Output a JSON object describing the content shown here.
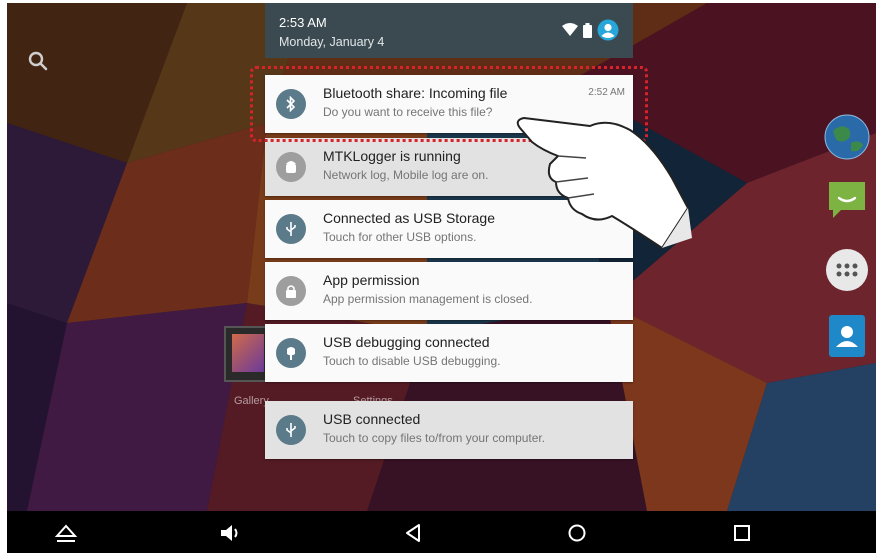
{
  "status_bar": {
    "time": "2:53 AM",
    "date": "Monday, January 4",
    "icons": [
      "wifi-icon",
      "battery-icon",
      "user-account-icon"
    ]
  },
  "notifications": [
    {
      "icon": "bluetooth-icon",
      "icon_color": "#5b7a8a",
      "title": "Bluetooth share: Incoming file",
      "subtitle": "Do you want to receive this file?",
      "time": "2:52 AM"
    },
    {
      "icon": "android-icon",
      "icon_color": "#9e9e9e",
      "title": "MTKLogger is running",
      "subtitle": "Network log, Mobile log are on."
    },
    {
      "icon": "usb-icon",
      "icon_color": "#5b7a8a",
      "title": "Connected as USB Storage",
      "subtitle": "Touch for other USB options."
    },
    {
      "icon": "lock-icon",
      "icon_color": "#9e9e9e",
      "title": "App permission",
      "subtitle": "App permission management is closed."
    },
    {
      "icon": "debug-icon",
      "icon_color": "#5b7a8a",
      "title": "USB debugging connected",
      "subtitle": "Touch to disable USB debugging."
    },
    {
      "icon": "usb-icon",
      "icon_color": "#5b7a8a",
      "title": "USB connected",
      "subtitle": "Touch to copy files to/from your computer."
    }
  ],
  "home_screen": {
    "labels": [
      "Gallery",
      "Settings"
    ],
    "dock_icons": [
      "browser-icon",
      "messaging-icon",
      "app-drawer-icon",
      "contacts-icon"
    ]
  },
  "nav_bar": [
    "eject-icon",
    "volume-icon",
    "back-icon",
    "home-icon",
    "recents-icon"
  ],
  "colors": {
    "highlight": "#d8232a",
    "shade_header": "#3b4a50"
  }
}
